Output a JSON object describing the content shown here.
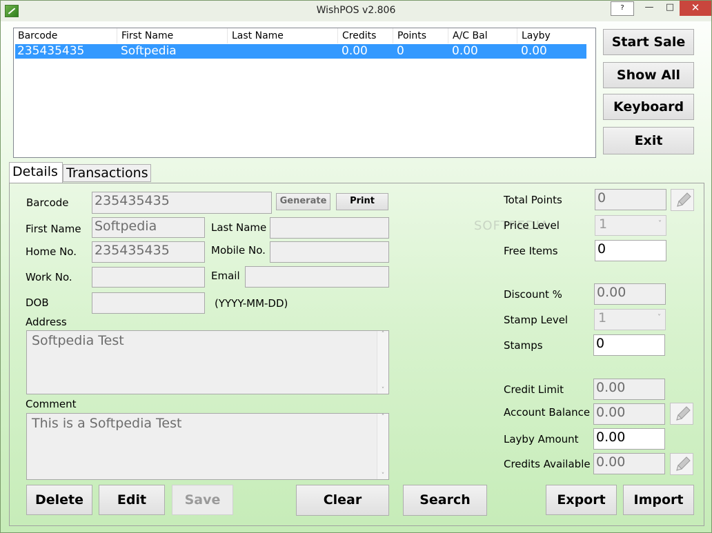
{
  "window": {
    "title": "WishPOS v2.806",
    "help": "?",
    "minimize": "—",
    "maximize": "□",
    "close": "✕"
  },
  "list": {
    "columns": [
      "Barcode",
      "First Name",
      "Last Name",
      "Credits",
      "Points",
      "A/C Bal",
      "Layby"
    ],
    "rows": [
      {
        "barcode": "235435435",
        "first_name": "Softpedia",
        "last_name": "",
        "credits": "0.00",
        "points": "0",
        "ac_bal": "0.00",
        "layby": "0.00",
        "selected": true
      }
    ]
  },
  "side_buttons": {
    "start_sale": "Start Sale",
    "show_all": "Show All",
    "keyboard": "Keyboard",
    "exit": "Exit"
  },
  "tabs": {
    "details": "Details",
    "transactions": "Transactions",
    "active": "Details"
  },
  "form": {
    "barcode_label": "Barcode",
    "barcode": "235435435",
    "generate": "Generate",
    "print": "Print",
    "first_name_label": "First Name",
    "first_name": "Softpedia",
    "last_name_label": "Last Name",
    "last_name": "",
    "home_no_label": "Home No.",
    "home_no": "235435435",
    "mobile_no_label": "Mobile No.",
    "mobile_no": "",
    "work_no_label": "Work No.",
    "work_no": "",
    "email_label": "Email",
    "email": "",
    "dob_label": "DOB",
    "dob": "",
    "dob_hint": "(YYYY-MM-DD)",
    "address_label": "Address",
    "address": "Softpedia Test",
    "comment_label": "Comment",
    "comment": "This is a Softpedia Test"
  },
  "stats": {
    "total_points_label": "Total Points",
    "total_points": "0",
    "price_level_label": "Price Level",
    "price_level": "1",
    "free_items_label": "Free Items",
    "free_items": "0",
    "discount_label": "Discount %",
    "discount": "0.00",
    "stamp_level_label": "Stamp Level",
    "stamp_level": "1",
    "stamps_label": "Stamps",
    "stamps": "0",
    "credit_limit_label": "Credit Limit",
    "credit_limit": "0.00",
    "account_balance_label": "Account Balance",
    "account_balance": "0.00",
    "layby_amount_label": "Layby Amount",
    "layby_amount": "0.00",
    "credits_available_label": "Credits Available",
    "credits_available": "0.00"
  },
  "bottom_buttons": {
    "delete": "Delete",
    "edit": "Edit",
    "save": "Save",
    "clear": "Clear",
    "search": "Search",
    "export": "Export",
    "import": "Import"
  },
  "watermark": "SOFTPEDIA"
}
